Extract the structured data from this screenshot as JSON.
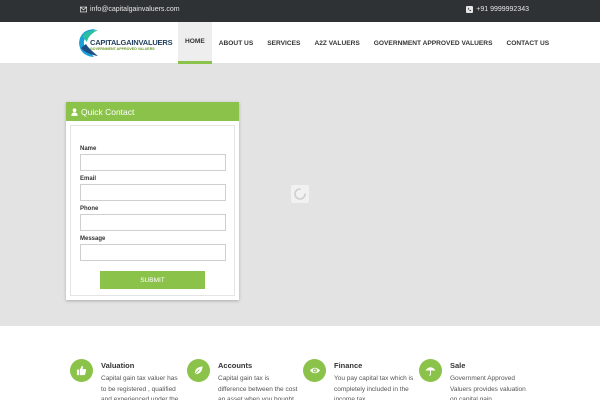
{
  "topbar": {
    "email": "info@capitalgainvaluers.com",
    "phone": "+91 9999992343"
  },
  "logo": {
    "name": "CAPITALGAINVALUERS",
    "tagline": "GOVERNMENT APPROVED VALUERS"
  },
  "nav": {
    "items": [
      {
        "label": "HOME",
        "active": true
      },
      {
        "label": "ABOUT US"
      },
      {
        "label": "SERVICES"
      },
      {
        "label": "A2Z VALUERS"
      },
      {
        "label": "GOVERNMENT APPROVED VALUERS"
      },
      {
        "label": "CONTACT US"
      }
    ]
  },
  "quick_contact": {
    "title": "Quick Contact",
    "fields": [
      {
        "label": "Name",
        "value": ""
      },
      {
        "label": "Email",
        "value": ""
      },
      {
        "label": "Phone",
        "value": ""
      },
      {
        "label": "Message",
        "value": ""
      }
    ],
    "submit_label": "SUBMIT"
  },
  "features": [
    {
      "icon": "thumbs-up-icon",
      "title": "Valuation",
      "text": "Capital gain tax valuer has to be registered , qualified and experienced under the"
    },
    {
      "icon": "leaf-icon",
      "title": "Accounts",
      "text": "Capital gain tax is difference between the cost an asset when you bought it"
    },
    {
      "icon": "eye-icon",
      "title": "Finance",
      "text": "You pay capital tax which is completely included in the income tax"
    },
    {
      "icon": "umbrella-icon",
      "title": "Sale",
      "text": "Government Approved Valuers provides valuation on capital gain"
    }
  ],
  "colors": {
    "accent": "#8bc34a",
    "topbar": "#2f3235",
    "hero_bg": "#e3e3e3"
  }
}
